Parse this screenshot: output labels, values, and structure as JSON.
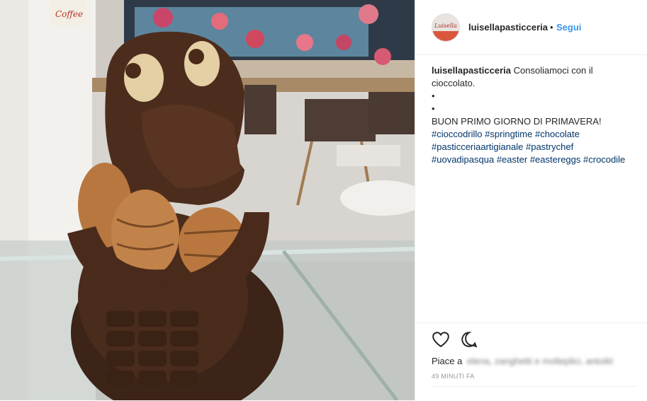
{
  "post": {
    "photo_alt": "chocolate crocodile",
    "header": {
      "avatar_text": "Luisella",
      "username": "luisellapasticceria",
      "separator": "•",
      "follow_label": "Segui"
    },
    "caption": {
      "username": "luisellapasticceria",
      "line1": "Consoliamoci con il cioccolato.",
      "bullet1": "•",
      "bullet2": "•",
      "line2": "BUON PRIMO GIORNO DI PRIMAVERA!",
      "hashtags": [
        "#cioccodrillo",
        "#springtime",
        "#chocolate",
        "#pasticceriaartigianale",
        "#pastrychef",
        "#uovadipasqua",
        "#easter",
        "#eastereggs",
        "#crocodile"
      ]
    },
    "actions": {
      "like_icon": "heart-icon",
      "comment_icon": "comment-icon",
      "likes_prefix": "Piace a",
      "likes_names": "elena, zanghetti e molteplici, antoikt",
      "timestamp": "49 MINUTI FA"
    },
    "shop_sign": "Coffee"
  }
}
